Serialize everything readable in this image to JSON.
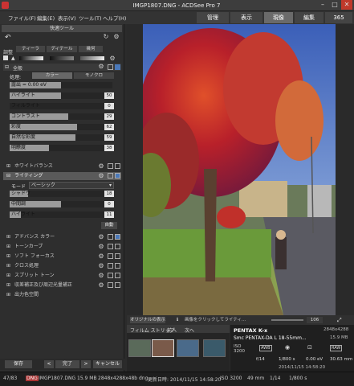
{
  "window": {
    "title": "IMGP1807.DNG - ACDSee Pro 7",
    "minimize": "–",
    "maximize": "□",
    "close": "✕"
  },
  "menu": {
    "items": [
      "ファイル(F)",
      "編集(E)",
      "表示(V)",
      "ツール(T)",
      "ヘルプ(H)"
    ]
  },
  "modes": {
    "manage": "管理",
    "view": "表示",
    "develop": "現像",
    "edit": "編集",
    "online": "365"
  },
  "left_panel": {
    "header": "快適ツール",
    "tabs": [
      "ティーラ",
      "ディテール",
      "幾何"
    ],
    "basic_label": "調整",
    "general": "全般",
    "process_label": "処理:",
    "process_tabs": [
      "カラー",
      "モノクロ"
    ],
    "sliders": [
      {
        "label": "露出 = 0.00 eV",
        "value": "",
        "pct": 0.5
      },
      {
        "label": "ハイライト",
        "value": "50",
        "pct": 0.5
      },
      {
        "label": "フィルライト",
        "value": "0",
        "pct": 0.0
      },
      {
        "label": "コントラスト",
        "value": "29",
        "pct": 0.57
      },
      {
        "label": "彩度",
        "value": "62",
        "pct": 0.66
      },
      {
        "label": "自然な彩度",
        "value": "59",
        "pct": 0.64
      },
      {
        "label": "明瞭度",
        "value": "38",
        "pct": 0.38
      }
    ],
    "whitebalance": "ホワイトバランス",
    "lighting": "ライティング",
    "mode_label": "モード",
    "mode_value": "ベーシック",
    "light_sliders": [
      {
        "label": "シャドウ",
        "value": "18",
        "pct": 0.18
      },
      {
        "label": "中間調",
        "value": "0",
        "pct": 0.5
      },
      {
        "label": "ハイライト",
        "value": "11",
        "pct": 0.11
      }
    ],
    "auto": "自動",
    "sections": [
      "アドバンス カラー",
      "トーンカーブ",
      "ソフト フォーカス",
      "クロス処理",
      "スプリット トーン",
      "収差補正及び周辺光量補正",
      "出力色空間"
    ],
    "save": "保存",
    "done": "完了",
    "cancel": "キャンセル",
    "prev": "<",
    "next": ">"
  },
  "viewer": {
    "original_btn": "オリジナルの表示",
    "hint": "画像をクリックしてライティ...",
    "zoom": "106"
  },
  "filmstrip": {
    "label": "フィルム ストリップ",
    "prev": "前へ",
    "next": "次へ"
  },
  "info": {
    "camera": "PENTAX K-x",
    "dims": "2848x4288",
    "lens": "Smc PENTAX-DA L 18-55mm...",
    "size": "15.9 MB",
    "iso": "ISO 3200",
    "aperture": "f/14",
    "shutter": "1/800 s",
    "ev": "0.00 eV",
    "focal": "30.63 mm",
    "datetime": "2014/11/15 14:58:20",
    "awb": "AWB",
    "raw": "RAW"
  },
  "status": {
    "index": "47/83",
    "format": "DNG",
    "filename": "IMGP1807.DNG",
    "size": "15.9 MB",
    "dims": "2848x4288x48b dng",
    "date": "更新日時: 2014/11/15 14:58:20",
    "iso": "ISO 3200",
    "focal": "49 mm",
    "ratio": "1/14",
    "shutter": "1/800 s"
  }
}
